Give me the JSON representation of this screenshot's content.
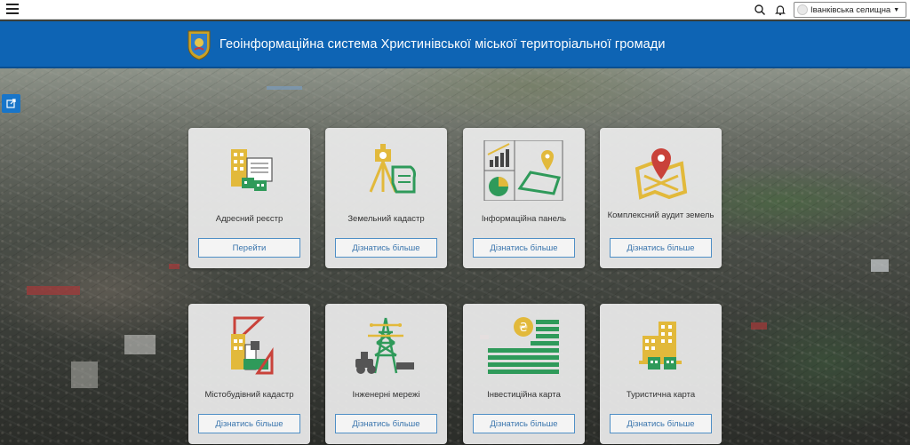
{
  "topbar": {
    "user_label": "Іванківська селищна",
    "icons": [
      "menu-icon",
      "search-icon",
      "bell-icon",
      "avatar",
      "caret-down-icon"
    ]
  },
  "header": {
    "title": "Геоінформаційна система Христинівської міської територіальної громади"
  },
  "colors": {
    "header_bg": "#0e64b4",
    "accent_gold": "#e0b82e",
    "accent_green": "#2f9a5a",
    "accent_red": "#c9423a",
    "button_text": "#3a75ad"
  },
  "cards": [
    {
      "label": "Адресний реєстр",
      "button": "Перейти",
      "icon": "address-registry-icon"
    },
    {
      "label": "Земельний кадастр",
      "button": "Дізнатись більше",
      "icon": "land-cadastre-icon"
    },
    {
      "label": "Інформаційна панель",
      "button": "Дізнатись більше",
      "icon": "dashboard-icon"
    },
    {
      "label": "Комплексний аудит земель",
      "button": "Дізнатись більше",
      "icon": "land-audit-icon"
    },
    {
      "label": "Містобудівний кадастр",
      "button": "Дізнатись більше",
      "icon": "urban-cadastre-icon"
    },
    {
      "label": "Інженерні мережі",
      "button": "Дізнатись більше",
      "icon": "engineering-networks-icon"
    },
    {
      "label": "Інвестиційна карта",
      "button": "Дізнатись більше",
      "icon": "investment-map-icon"
    },
    {
      "label": "Туристична карта",
      "button": "Дізнатись більше",
      "icon": "tourist-map-icon"
    }
  ]
}
